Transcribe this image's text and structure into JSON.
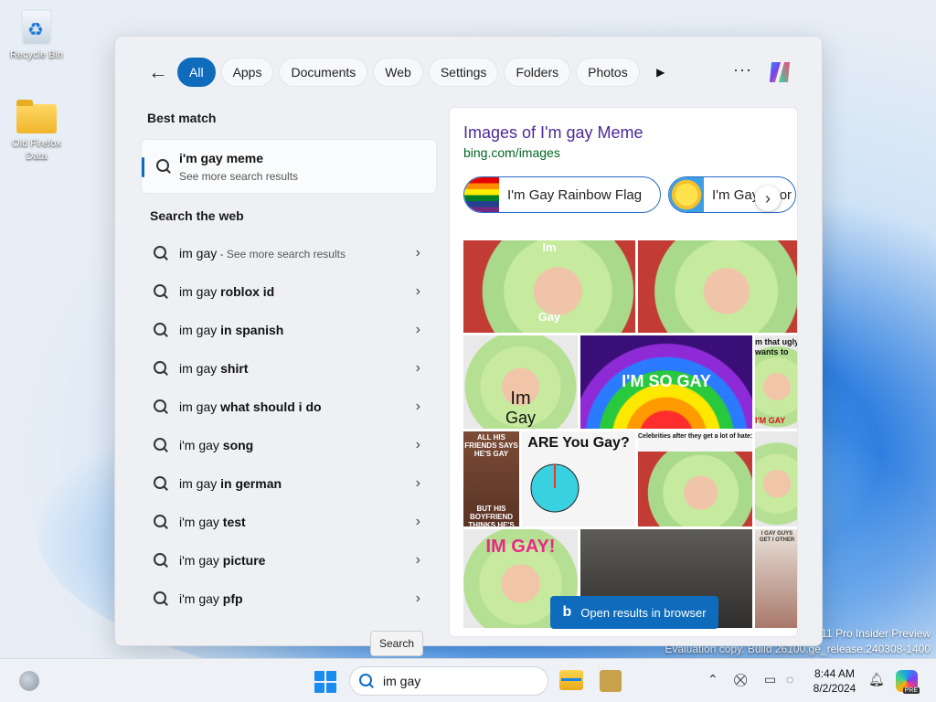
{
  "desktop": {
    "icons": [
      {
        "label": "Recycle Bin"
      },
      {
        "label": "Old Firefox Data"
      }
    ],
    "watermark": {
      "line1": "11 Pro Insider Preview",
      "line2": "Evaluation copy. Build 26100.ge_release.240308-1400"
    }
  },
  "search_flyout": {
    "filters": [
      "All",
      "Apps",
      "Documents",
      "Web",
      "Settings",
      "Folders",
      "Photos"
    ],
    "active_filter": "All",
    "more_label": "···",
    "best_match": {
      "heading": "Best match",
      "title": "i'm gay meme",
      "subtitle": "See more search results"
    },
    "web": {
      "heading": "Search the web",
      "items": [
        {
          "prefix": "im gay",
          "suffix": "",
          "sub": " - See more search results"
        },
        {
          "prefix": "im gay ",
          "suffix": "roblox id",
          "sub": ""
        },
        {
          "prefix": "im gay ",
          "suffix": "in spanish",
          "sub": ""
        },
        {
          "prefix": "im gay ",
          "suffix": "shirt",
          "sub": ""
        },
        {
          "prefix": "im gay ",
          "suffix": "what should i do",
          "sub": ""
        },
        {
          "prefix": "i'm gay ",
          "suffix": "song",
          "sub": ""
        },
        {
          "prefix": "im gay ",
          "suffix": "in german",
          "sub": ""
        },
        {
          "prefix": "i'm gay ",
          "suffix": "test",
          "sub": ""
        },
        {
          "prefix": "i'm gay ",
          "suffix": "picture",
          "sub": ""
        },
        {
          "prefix": "i'm gay ",
          "suffix": "pfp",
          "sub": ""
        }
      ]
    },
    "preview": {
      "title": "Images of I'm gay Meme",
      "url": "bing.com/images",
      "pills": [
        "I'm Gay Rainbow Flag",
        "I'm Gay Spor"
      ],
      "image_texts": {
        "im": "Im",
        "gay": "Gay",
        "im_gay_big": "Im",
        "gay_big": "Gay",
        "so_gay": "I'M SO GAY",
        "ugly": "m that ugly",
        "wants": "wants to",
        "tsgay": "I'M GAY",
        "friends": "ALL HIS FRIENDS SAYS HE'S GAY",
        "boyfriend": "BUT HIS BOYFRIEND THINKS HE'S GAY",
        "are_you_gay": "ARE You Gay?",
        "celebrities": "Celebrities after they get a lot of hate:",
        "im_gay_bang": "IM GAY!",
        "caption_small": "I GAY GUYS GET I OTHER"
      },
      "open_button": "Open results in browser"
    }
  },
  "tooltip": "Search",
  "taskbar": {
    "search_value": "im gay",
    "clock_time": "8:44 AM",
    "clock_date": "8/2/2024",
    "copilot_badge": "PRE"
  }
}
